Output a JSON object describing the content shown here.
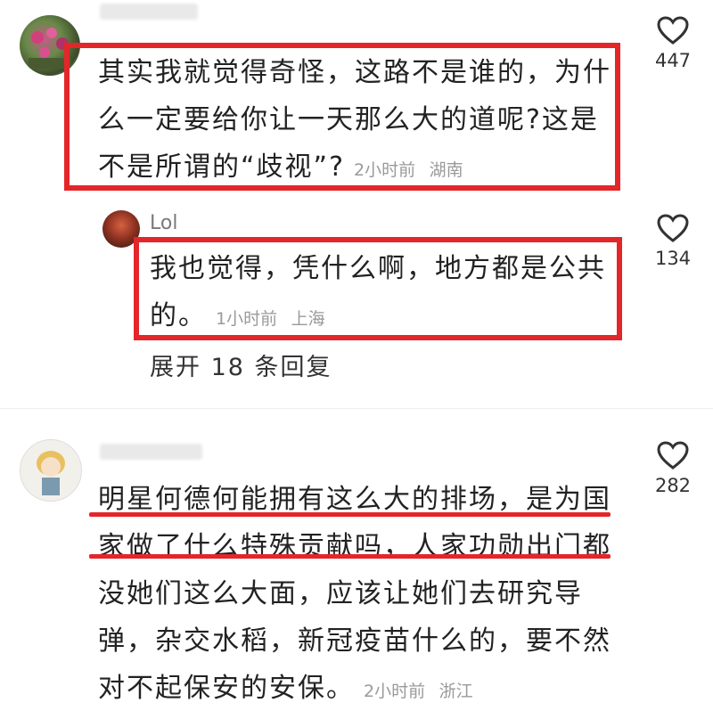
{
  "comments": [
    {
      "text_lines": [
        "其实我就觉得奇怪，这路不是谁的，为什",
        "么一定要给你让一天那么大的道呢?这是",
        "不是所谓的“歧视”?"
      ],
      "time": "2小时前",
      "location": "湖南",
      "likes": "447"
    },
    {
      "username": "Lol",
      "text_lines": [
        "我也觉得，凭什么啊，地方都是公共",
        "的。"
      ],
      "time": "1小时前",
      "location": "上海",
      "likes": "134",
      "expand_label": "展开 18 条回复"
    },
    {
      "text_lines": [
        "明星何德何能拥有这么大的排场，是为国",
        "家做了什么特殊贡献吗，人家功勋出门都",
        "没她们这么大面，应该让她们去研究导",
        "弹，杂交水稻，新冠疫苗什么的，要不然",
        "对不起保安的安保。"
      ],
      "time": "2小时前",
      "location": "浙江",
      "likes": "282"
    }
  ],
  "colors": {
    "highlight": "#e3262a",
    "meta_text": "#9a9a9a"
  },
  "icons": {
    "like": "heart-outline-icon"
  }
}
